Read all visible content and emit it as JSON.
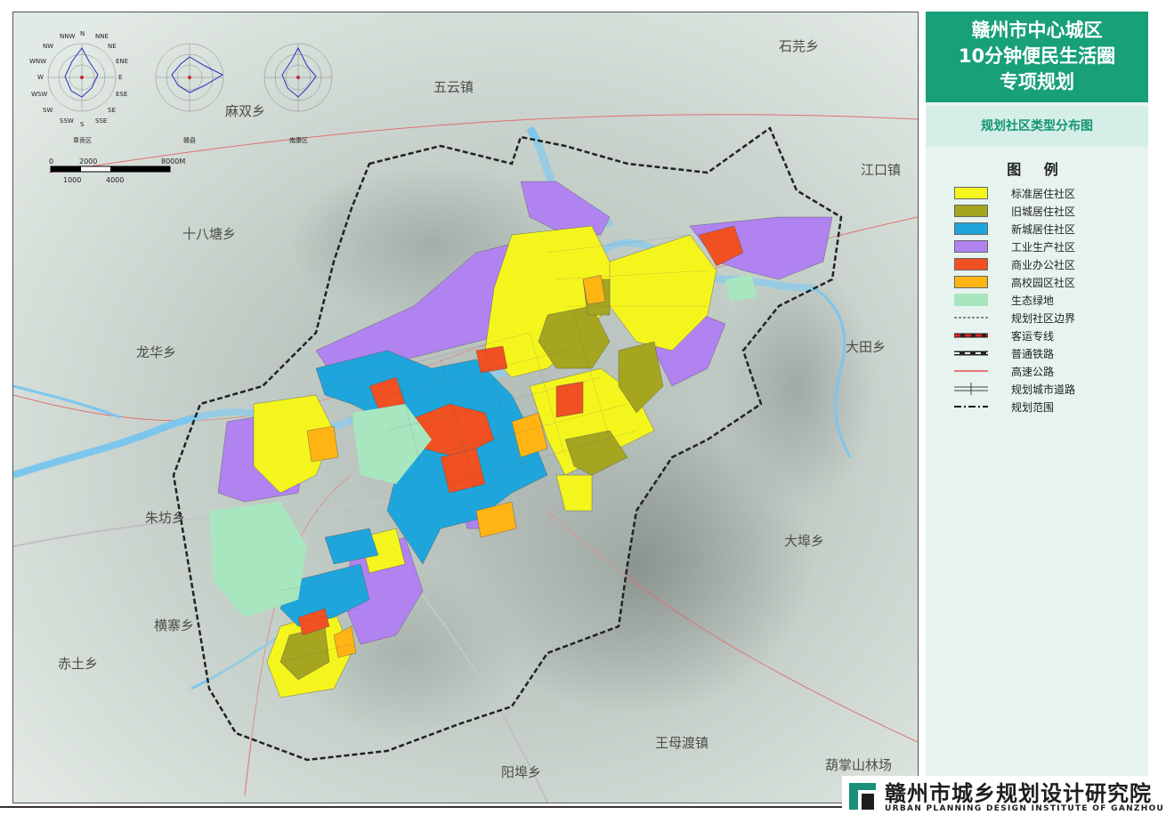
{
  "title": {
    "line1": "赣州市中心城区",
    "line2": "10分钟便民生活圈",
    "line3": "专项规划"
  },
  "subtitle": "规划社区类型分布图",
  "legend": {
    "title": "图 例",
    "items": [
      {
        "label": "标准居住社区",
        "color": "#f5f51e"
      },
      {
        "label": "旧城居住社区",
        "color": "#a5a520"
      },
      {
        "label": "新城居住社区",
        "color": "#1ea6dc"
      },
      {
        "label": "工业生产社区",
        "color": "#b083f0"
      },
      {
        "label": "商业办公社区",
        "color": "#f05022"
      },
      {
        "label": "高校园区社区",
        "color": "#ffb414"
      },
      {
        "label": "生态绿地",
        "color": "#a8e6c0"
      },
      {
        "label": "规划社区边界"
      },
      {
        "label": "客运专线"
      },
      {
        "label": "普通铁路"
      },
      {
        "label": "高速公路"
      },
      {
        "label": "规划城市道路"
      },
      {
        "label": "规划范围"
      }
    ]
  },
  "places": [
    {
      "name": "石芫乡"
    },
    {
      "name": "五云镇"
    },
    {
      "name": "麻双乡"
    },
    {
      "name": "江口镇"
    },
    {
      "name": "十八塘乡"
    },
    {
      "name": "龙华乡"
    },
    {
      "name": "大田乡"
    },
    {
      "name": "朱坊乡"
    },
    {
      "name": "大埠乡"
    },
    {
      "name": "横寨乡"
    },
    {
      "name": "赤土乡"
    },
    {
      "name": "王母渡镇"
    },
    {
      "name": "阳埠乡"
    },
    {
      "name": "葫掌山林场"
    }
  ],
  "wind_roses": [
    {
      "label": "章贡区"
    },
    {
      "label": "赣县"
    },
    {
      "label": "南康区"
    }
  ],
  "rose_directions": [
    "N",
    "NNE",
    "NE",
    "ENE",
    "E",
    "ESE",
    "SE",
    "SSE",
    "S",
    "SSW",
    "SW",
    "WSW",
    "W",
    "WNW",
    "NW",
    "NNW"
  ],
  "scale_bar": {
    "top_labels": [
      "0",
      "2000",
      "8000M"
    ],
    "bottom_labels": [
      "1000",
      "4000"
    ]
  },
  "footer": {
    "org_name": "赣州市城乡规划设计研究院",
    "org_en": "URBAN PLANNING DESIGN INSTITUTE OF GANZHOU"
  },
  "colors": {
    "accent": "#18a078",
    "river": "#7cc6ee",
    "background_terrain": "#c8d2cb"
  }
}
